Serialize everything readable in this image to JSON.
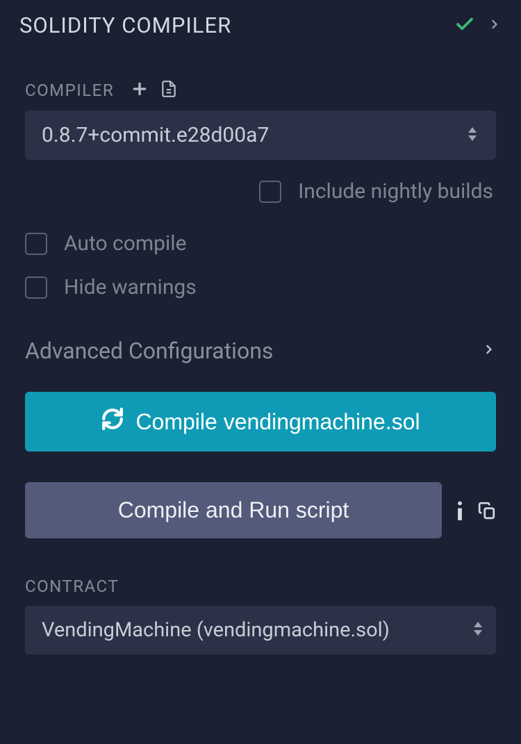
{
  "header": {
    "title": "SOLIDITY COMPILER"
  },
  "compiler": {
    "label": "COMPILER",
    "selected": "0.8.7+commit.e28d00a7"
  },
  "checkboxes": {
    "nightly": "Include nightly builds",
    "auto": "Auto compile",
    "hide": "Hide warnings"
  },
  "advanced": {
    "label": "Advanced Configurations"
  },
  "buttons": {
    "compile": "Compile vendingmachine.sol",
    "compile_run": "Compile and Run script"
  },
  "contract": {
    "label": "CONTRACT",
    "selected": "VendingMachine (vendingmachine.sol)"
  }
}
